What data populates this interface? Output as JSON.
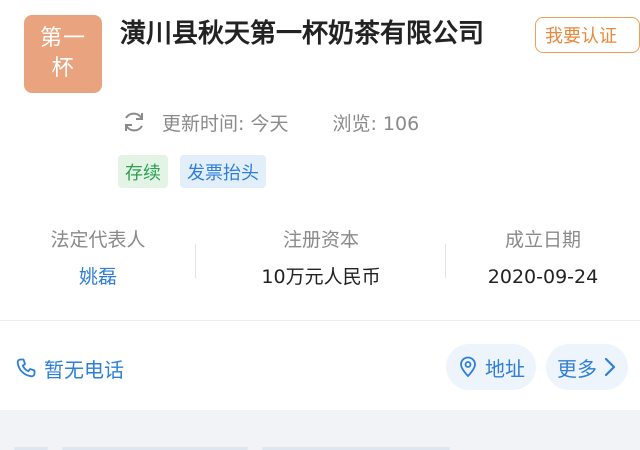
{
  "company": {
    "logo_lines": [
      "第一",
      "杯"
    ],
    "name": "潢川县秋天第一杯奶茶有限公司",
    "claim_label": "我要认证"
  },
  "meta": {
    "refresh_icon": "refresh-icon",
    "updated": "更新时间: 今天",
    "views": "浏览: 106"
  },
  "tags": [
    "存续",
    "发票抬头"
  ],
  "info": [
    {
      "label": "法定代表人",
      "value": "姚磊"
    },
    {
      "label": "注册资本",
      "value": "10万元人民币"
    },
    {
      "label": "成立日期",
      "value": "2020-09-24"
    }
  ],
  "actions": {
    "phone": "暂无电话",
    "address": "地址",
    "more": "更多"
  },
  "colors": {
    "logo_bg": "#e9a37f",
    "accent_blue": "#2f7fd8",
    "claim_orange": "#e8883a",
    "status_green": "#2e9e4f"
  }
}
